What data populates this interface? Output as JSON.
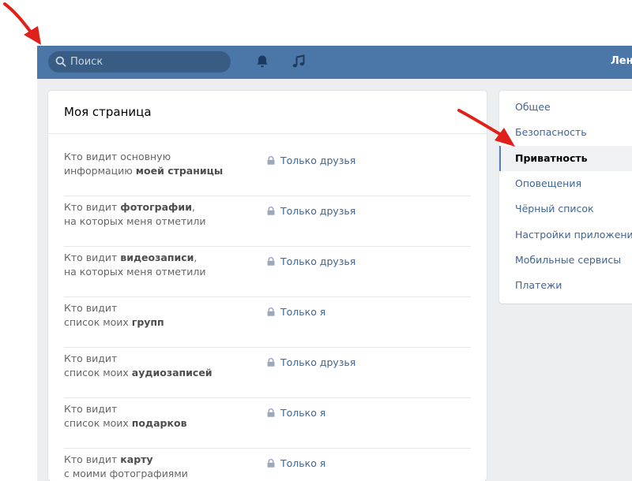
{
  "header": {
    "search": {
      "placeholder": "Поиск"
    },
    "icons": [
      "bell-icon",
      "music-note-icon"
    ],
    "user_name": "Лена"
  },
  "privacy": {
    "title": "Моя страница",
    "rows": [
      {
        "pre": "Кто видит основную",
        "line2_pre": "информацию ",
        "bold": "моей страницы",
        "post": "",
        "value": "Только друзья"
      },
      {
        "pre": "Кто видит ",
        "bold": "фотографии",
        "post": ",",
        "line2": "на которых меня отметили",
        "value": "Только друзья"
      },
      {
        "pre": "Кто видит ",
        "bold": "видеозаписи",
        "post": ",",
        "line2": "на которых меня отметили",
        "value": "Только друзья"
      },
      {
        "pre": "Кто видит",
        "line2_pre": "список моих ",
        "bold": "групп",
        "value": "Только я"
      },
      {
        "pre": "Кто видит",
        "line2_pre": "список моих ",
        "bold": "аудиозаписей",
        "value": "Только друзья"
      },
      {
        "pre": "Кто видит",
        "line2_pre": "список моих ",
        "bold": "подарков",
        "value": "Только я"
      },
      {
        "pre": "Кто видит ",
        "bold": "карту",
        "line2": "с моими фотографиями",
        "value": "Только я"
      }
    ]
  },
  "settings_menu": {
    "items": [
      {
        "label": "Общее",
        "active": false
      },
      {
        "label": "Безопасность",
        "active": false
      },
      {
        "label": "Приватность",
        "active": true
      },
      {
        "label": "Оповещения",
        "active": false
      },
      {
        "label": "Чёрный список",
        "active": false
      },
      {
        "label": "Настройки приложений",
        "active": false
      },
      {
        "label": "Мобильные сервисы",
        "active": false
      },
      {
        "label": "Платежи",
        "active": false
      }
    ]
  },
  "colors": {
    "header": "#4a76a8",
    "link": "#3f6594",
    "annotation_arrow": "#e0201b",
    "page_bg": "#edeef0"
  }
}
